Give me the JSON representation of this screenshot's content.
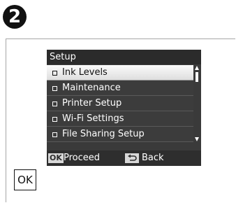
{
  "step": {
    "number": "2"
  },
  "lcd": {
    "title": "Setup",
    "menu_items": [
      {
        "label": "Ink Levels",
        "selected": true
      },
      {
        "label": "Maintenance",
        "selected": false
      },
      {
        "label": "Printer Setup",
        "selected": false
      },
      {
        "label": "Wi-Fi Settings",
        "selected": false
      },
      {
        "label": "File Sharing Setup",
        "selected": false
      }
    ],
    "footer": {
      "ok_badge": "OK",
      "proceed_label": "Proceed",
      "back_label": "Back"
    }
  },
  "ok_button": {
    "label": "OK"
  },
  "colors": {
    "screen_bg": "#3a3a3a",
    "selection_bg": "#f0f0f0",
    "badge_bg": "#111111"
  }
}
